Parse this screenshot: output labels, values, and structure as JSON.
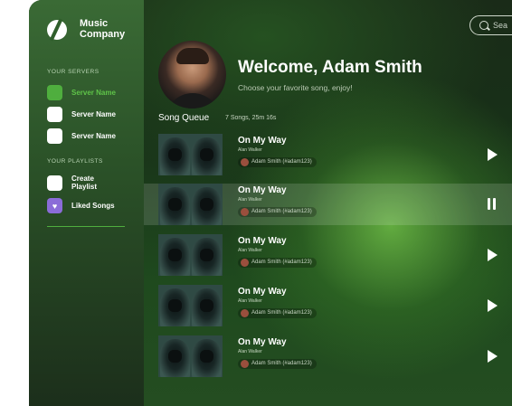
{
  "app": {
    "brand": "Music\nCompany",
    "brand_line1": "Music",
    "brand_line2": "Company"
  },
  "sidebar": {
    "servers_label": "YOUR SERVERS",
    "servers": [
      {
        "label": "Server Name",
        "active": true
      },
      {
        "label": "Server Name",
        "active": false
      },
      {
        "label": "Server Name",
        "active": false
      }
    ],
    "playlists_label": "YOUR PLAYLISTS",
    "playlists": [
      {
        "label": "Create\nPlaylist"
      },
      {
        "label": "Liked Songs"
      }
    ]
  },
  "search": {
    "placeholder": "Sea"
  },
  "header": {
    "welcome": "Welcome, Adam Smith",
    "subtitle": "Choose your favorite song, enjoy!"
  },
  "queue": {
    "title": "Song Queue",
    "meta": "7 Songs, 25m 16s",
    "songs": [
      {
        "title": "On My Way",
        "artist": "Alan Walker",
        "added_by": "Adam Smith (#adam123)",
        "state": "play"
      },
      {
        "title": "On My Way",
        "artist": "Alan Walker",
        "added_by": "Adam Smith (#adam123)",
        "state": "pause"
      },
      {
        "title": "On My Way",
        "artist": "Alan Walker",
        "added_by": "Adam Smith (#adam123)",
        "state": "play"
      },
      {
        "title": "On My Way",
        "artist": "Alan Walker",
        "added_by": "Adam Smith (#adam123)",
        "state": "play"
      },
      {
        "title": "On My Way",
        "artist": "Alan Walker",
        "added_by": "Adam Smith (#adam123)",
        "state": "play"
      }
    ]
  },
  "colors": {
    "accent": "#4fae3e",
    "liked": "#8b6cd8"
  }
}
